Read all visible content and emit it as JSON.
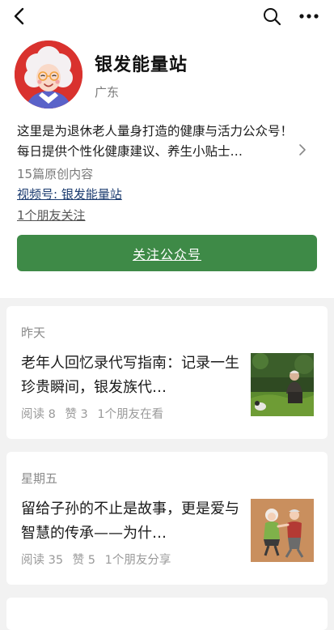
{
  "profile": {
    "name": "银发能量站",
    "region": "广东",
    "description": "这里是为退休老人量身打造的健康与活力公众号！每日提供个性化健康建议、养生小贴士…",
    "originals": "15篇原创内容",
    "channel": "视频号: 银发能量站",
    "friends_following": "1个朋友关注",
    "follow_button": "关注公众号"
  },
  "articles": [
    {
      "date": "昨天",
      "title": "老年人回忆录代写指南：记录一生珍贵瞬间，银发族代…",
      "reads": "阅读 8",
      "likes": "赞 3",
      "social": "1个朋友在看"
    },
    {
      "date": "星期五",
      "title": "留给子孙的不止是故事，更是爱与智慧的传承——为什…",
      "reads": "阅读 35",
      "likes": "赞 5",
      "social": "1个朋友分享"
    }
  ],
  "colors": {
    "accent_green": "#3e8a47",
    "link_blue": "#1b3b6f",
    "avatar_red": "#d9322e",
    "background": "#f2f2f2"
  },
  "icons": [
    "back-arrow-icon",
    "search-icon",
    "more-icon",
    "chevron-right-icon"
  ]
}
